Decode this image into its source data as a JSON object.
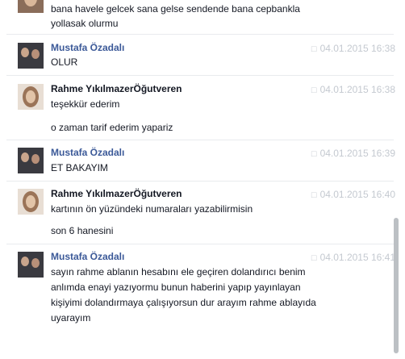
{
  "messages": [
    {
      "lines": [
        "bana havele gelcek sana gelse sendende bana cepbankla",
        "yollasak olurmu"
      ]
    },
    {
      "sender": "Mustafa Özadalı",
      "time": "04.01.2015 16:38",
      "lines": [
        "OLUR"
      ]
    },
    {
      "sender": "Rahme YıkılmazerÖğutveren",
      "time": "04.01.2015 16:38",
      "lines": [
        "teşekkür ederim",
        "o zaman tarif ederim yapariz"
      ]
    },
    {
      "sender": "Mustafa Özadalı",
      "time": "04.01.2015 16:39",
      "lines": [
        "ET BAKAYIM"
      ]
    },
    {
      "sender": "Rahme YıkılmazerÖğutveren",
      "time": "04.01.2015 16:40",
      "lines": [
        "kartının ön yüzündeki numaraları yazabilirmisin",
        "son 6 hanesini"
      ]
    },
    {
      "sender": "Mustafa Özadalı",
      "time": "04.01.2015 16:41",
      "lines": [
        "sayın rahme ablanın hesabını ele geçiren dolandırıcı benim",
        "anlımda enayi yazıyormu  bunun haberini yapıp yayınlayan",
        "kişiyimi dolandırmaya çalışıyorsun dur arayım rahme ablayıda",
        "uyarayım"
      ]
    }
  ],
  "icons": {
    "message_time": "speech-bubble-icon"
  },
  "colors": {
    "sender_blue": "#3b5998",
    "timestamp": "#c4c9d0",
    "text": "#141823"
  }
}
